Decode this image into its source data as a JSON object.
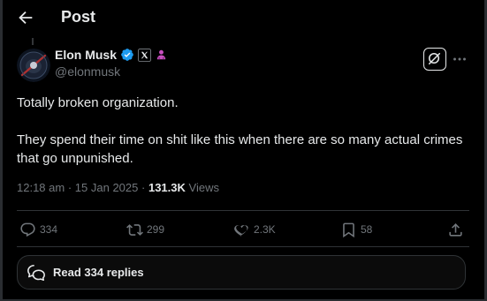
{
  "header": {
    "title": "Post",
    "back_icon": "arrow-left-icon"
  },
  "author": {
    "display_name": "Elon Musk",
    "handle": "@elonmusk",
    "badges": [
      "verified-badge-icon",
      "x-affiliate-badge-icon",
      "person-badge-icon"
    ]
  },
  "tweet": {
    "paragraphs": [
      "Totally broken organization.",
      "They spend their time on shit like this when there are so many actual crimes that go unpunished."
    ],
    "time": "12:18 am",
    "separator": "·",
    "date": "15 Jan 2025",
    "views_count": "131.3K",
    "views_label": "Views"
  },
  "actions": {
    "reply": "334",
    "repost": "299",
    "like": "2.3K",
    "bookmark": "58"
  },
  "replies": {
    "label": "Read 334 replies"
  },
  "colors": {
    "background": "#000000",
    "text": "#e7e9ea",
    "muted": "#71767b",
    "border": "#2f3336",
    "verified": "#1d9bf0",
    "person_badge": "#c850c0"
  }
}
